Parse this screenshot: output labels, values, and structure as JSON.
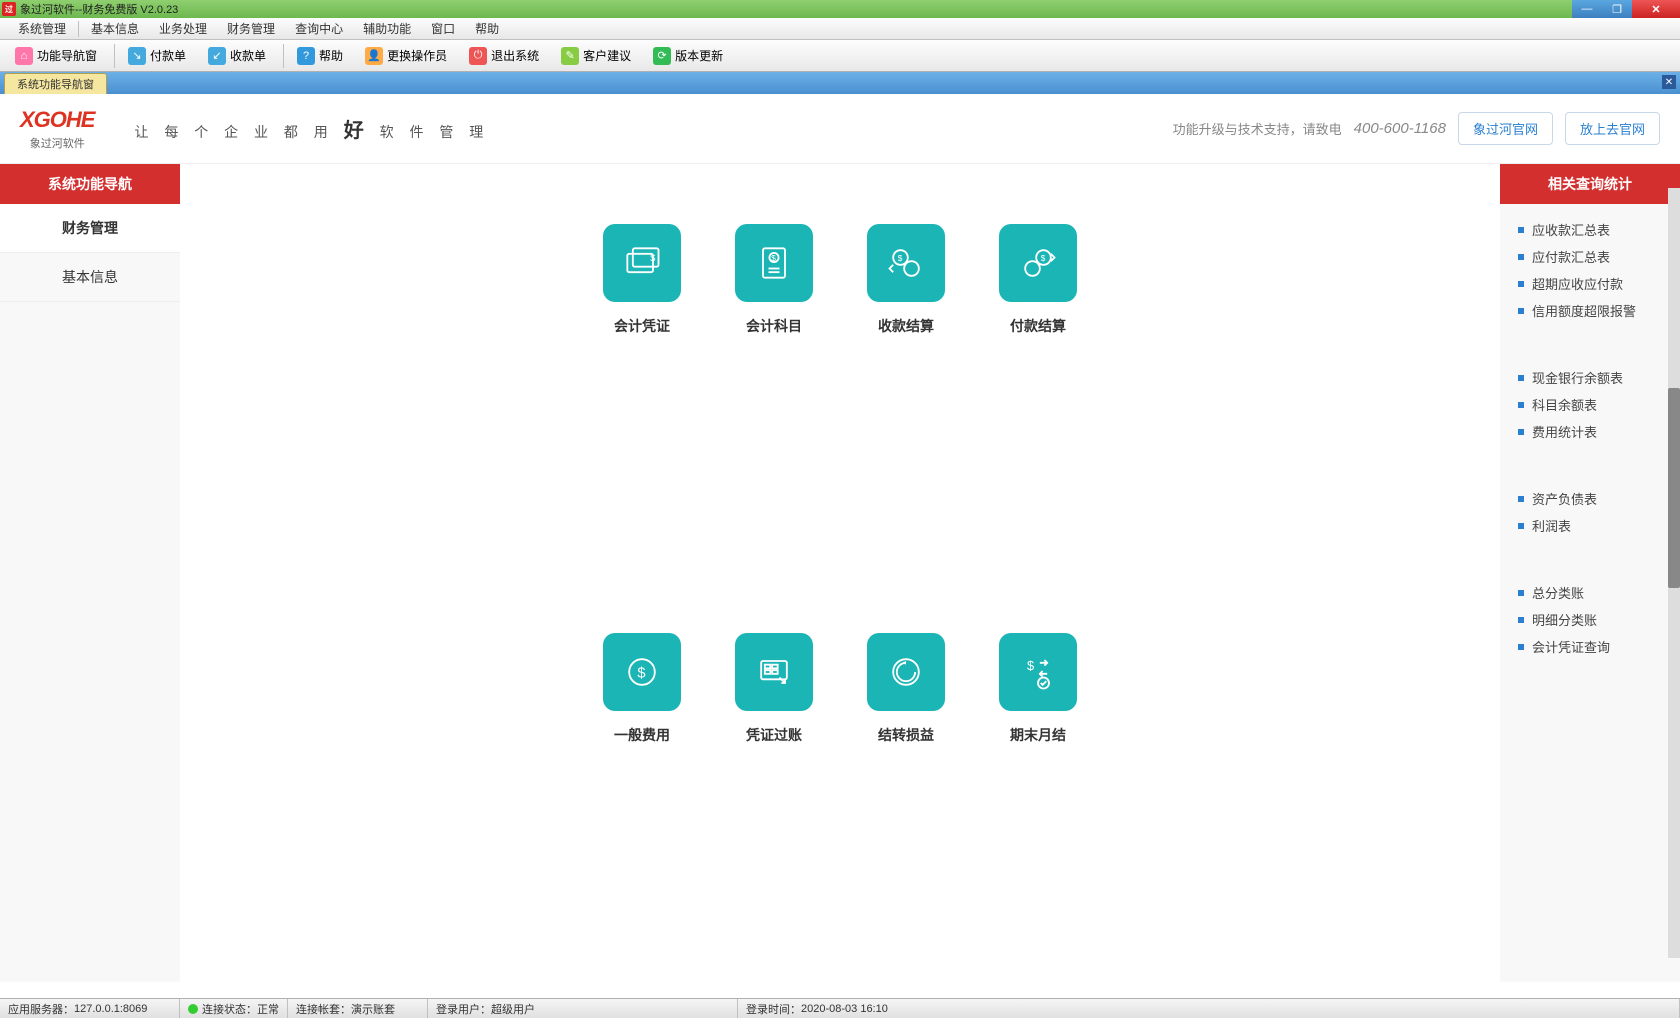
{
  "window": {
    "title": "象过河软件--财务免费版 V2.0.23"
  },
  "menubar": [
    "系统管理",
    "基本信息",
    "业务处理",
    "财务管理",
    "查询中心",
    "辅助功能",
    "窗口",
    "帮助"
  ],
  "toolbar": [
    {
      "label": "功能导航窗",
      "color": "#f7a"
    },
    {
      "label": "付款单",
      "color": "#4ad"
    },
    {
      "label": "收款单",
      "color": "#4ad"
    },
    {
      "label": "帮助",
      "color": "#39d"
    },
    {
      "label": "更换操作员",
      "color": "#fa4"
    },
    {
      "label": "退出系统",
      "color": "#e55"
    },
    {
      "label": "客户建议",
      "color": "#8c4"
    },
    {
      "label": "版本更新",
      "color": "#3b5"
    }
  ],
  "tab": {
    "label": "系统功能导航窗"
  },
  "header": {
    "logo": "XGOHE",
    "logo_sub": "象过河软件",
    "slogan_pre": "让 每 个 企 业 都 用",
    "slogan_big": "好",
    "slogan_post": "软 件 管 理",
    "support": "功能升级与技术支持，请致电",
    "phone": "400-600-1168",
    "btn1": "象过河官网",
    "btn2": "放上去官网"
  },
  "left_sidebar": {
    "title": "系统功能导航",
    "items": [
      "财务管理",
      "基本信息"
    ]
  },
  "cards": [
    "会计凭证",
    "会计科目",
    "收款结算",
    "付款结算",
    "一般费用",
    "凭证过账",
    "结转损益",
    "期末月结"
  ],
  "right_sidebar": {
    "title": "相关查询统计",
    "groups": [
      [
        "应收款汇总表",
        "应付款汇总表",
        "超期应收应付款",
        "信用额度超限报警"
      ],
      [
        "现金银行余额表",
        "科目余额表",
        "费用统计表"
      ],
      [
        "资产负债表",
        "利润表"
      ],
      [
        "总分类账",
        "明细分类账",
        "会计凭证查询"
      ]
    ]
  },
  "statusbar": {
    "server_label": "应用服务器：",
    "server": "127.0.0.1:8069",
    "conn_label": "连接状态：",
    "conn": "正常",
    "account_label": "连接帐套：",
    "account": "演示账套",
    "user_label": "登录用户：",
    "user": "超级用户",
    "time_label": "登录时间：",
    "time": "2020-08-03 16:10"
  }
}
